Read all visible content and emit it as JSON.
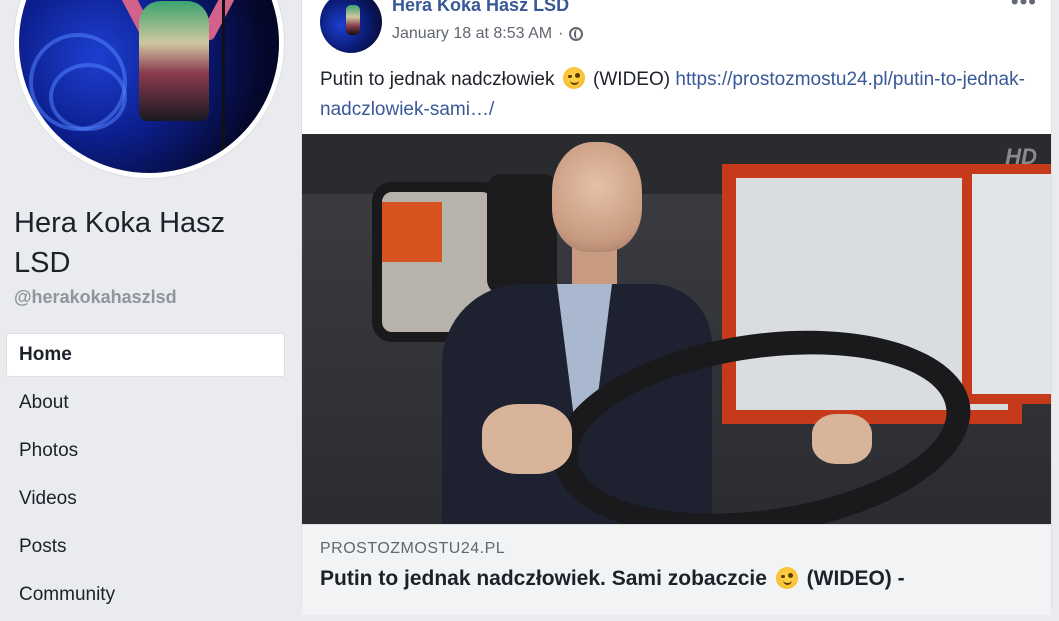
{
  "page": {
    "name": "Hera Koka Hasz LSD",
    "handle": "@herakokahaszlsd"
  },
  "sidebar": {
    "items": [
      {
        "label": "Home",
        "active": true
      },
      {
        "label": "About"
      },
      {
        "label": "Photos"
      },
      {
        "label": "Videos"
      },
      {
        "label": "Posts"
      },
      {
        "label": "Community"
      }
    ]
  },
  "post": {
    "author": "Hera Koka Hasz LSD",
    "timestamp": "January 18 at 8:53 AM",
    "separator": "·",
    "privacy_icon": "globe-icon",
    "more_icon": "•••",
    "text_before": "Putin to jednak nadczłowiek",
    "text_after": "(WIDEO)",
    "link_text": "https://prostozmostu24.pl/putin-to-jednak-nadczlowiek-sami…/",
    "emoji": "winking-face",
    "video_logo": "HD",
    "preview": {
      "domain": "PROSTOZMOSTU24.PL",
      "title_before": "Putin to jednak nadczłowiek. Sami zobaczcie",
      "title_after": "(WIDEO) -"
    }
  },
  "colors": {
    "background": "#e9ebee",
    "link": "#385898",
    "secondary_text": "#616770",
    "card": "#ffffff"
  }
}
